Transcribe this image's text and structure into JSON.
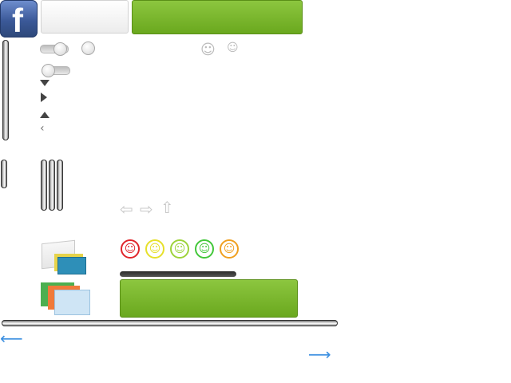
{
  "buttons": {
    "facebook": {
      "letter": "f"
    },
    "secondary_label": "",
    "primary_label": "",
    "primary_bottom_label": ""
  },
  "icons": {
    "facebook": "facebook-icon",
    "user": "user-icon",
    "arrow_left": "arrow-left-icon",
    "arrow_right": "arrow-right-icon",
    "arrow_up": "arrow-up-icon",
    "chevron_left": "chevron-left-icon"
  },
  "glyphs": {
    "user": "☺",
    "arrow_left": "⇦",
    "arrow_right": "⇨",
    "arrow_up": "⇧",
    "chevron_left": "‹",
    "curve_left": "⟵",
    "curve_right": "⟶"
  },
  "smileys": [
    {
      "face": "☺",
      "color": "#e0252b"
    },
    {
      "face": "☺",
      "color": "#e6e02a"
    },
    {
      "face": "☺",
      "color": "#9dd33a"
    },
    {
      "face": "☺",
      "color": "#43c73a"
    },
    {
      "face": "☺",
      "color": "#f0a020"
    }
  ],
  "colors": {
    "facebook_blue": "#3b5998",
    "green_button": "#7ab82d",
    "curve_arrow": "#3b8fe0"
  }
}
